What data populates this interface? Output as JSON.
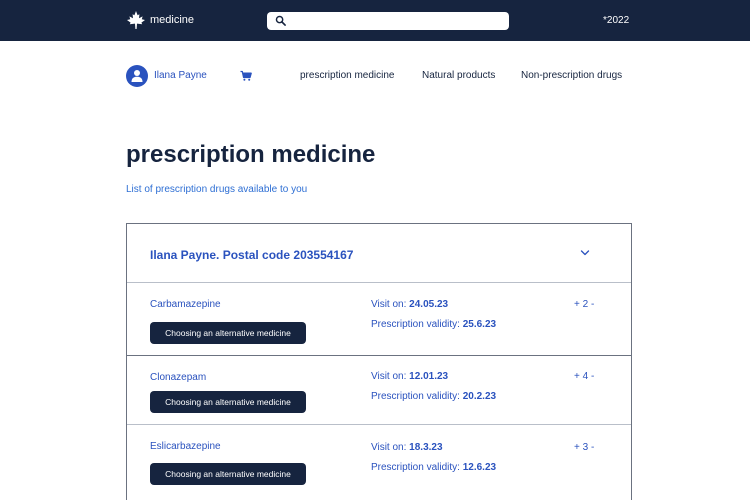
{
  "header": {
    "brand": "medicine",
    "logo_icon": "maple-leaf-icon",
    "search": {
      "value": "",
      "placeholder": ""
    },
    "year": "*2022"
  },
  "nav": {
    "user_name": "Ilana Payne",
    "cart_icon": "cart-icon",
    "links": [
      "prescription medicine",
      "Natural products",
      "Non-prescription drugs"
    ]
  },
  "main": {
    "title": "prescription medicine",
    "subtitle": "List of prescription drugs available to you",
    "panel": {
      "title": "Ilana Payne. Postal code 203554167",
      "visit_label": "Visit on:",
      "validity_label": "Prescription validity:",
      "alt_button_label": "Choosing an alternative medicine",
      "rows": [
        {
          "drug": "Carbamazepine",
          "visit": "24.05.23",
          "validity": "25.6.23",
          "quantity": "+ 2 -"
        },
        {
          "drug": "Clonazepam",
          "visit": "12.01.23",
          "validity": "20.2.23",
          "quantity": "+ 4 -"
        },
        {
          "drug": "Eslicarbazepine",
          "visit": "18.3.23",
          "validity": "12.6.23",
          "quantity": "+ 3 -"
        }
      ]
    }
  },
  "colors": {
    "navy": "#16243f",
    "accent_blue": "#2a52be",
    "link_blue": "#2e6fd4",
    "background": "#ffffff"
  }
}
